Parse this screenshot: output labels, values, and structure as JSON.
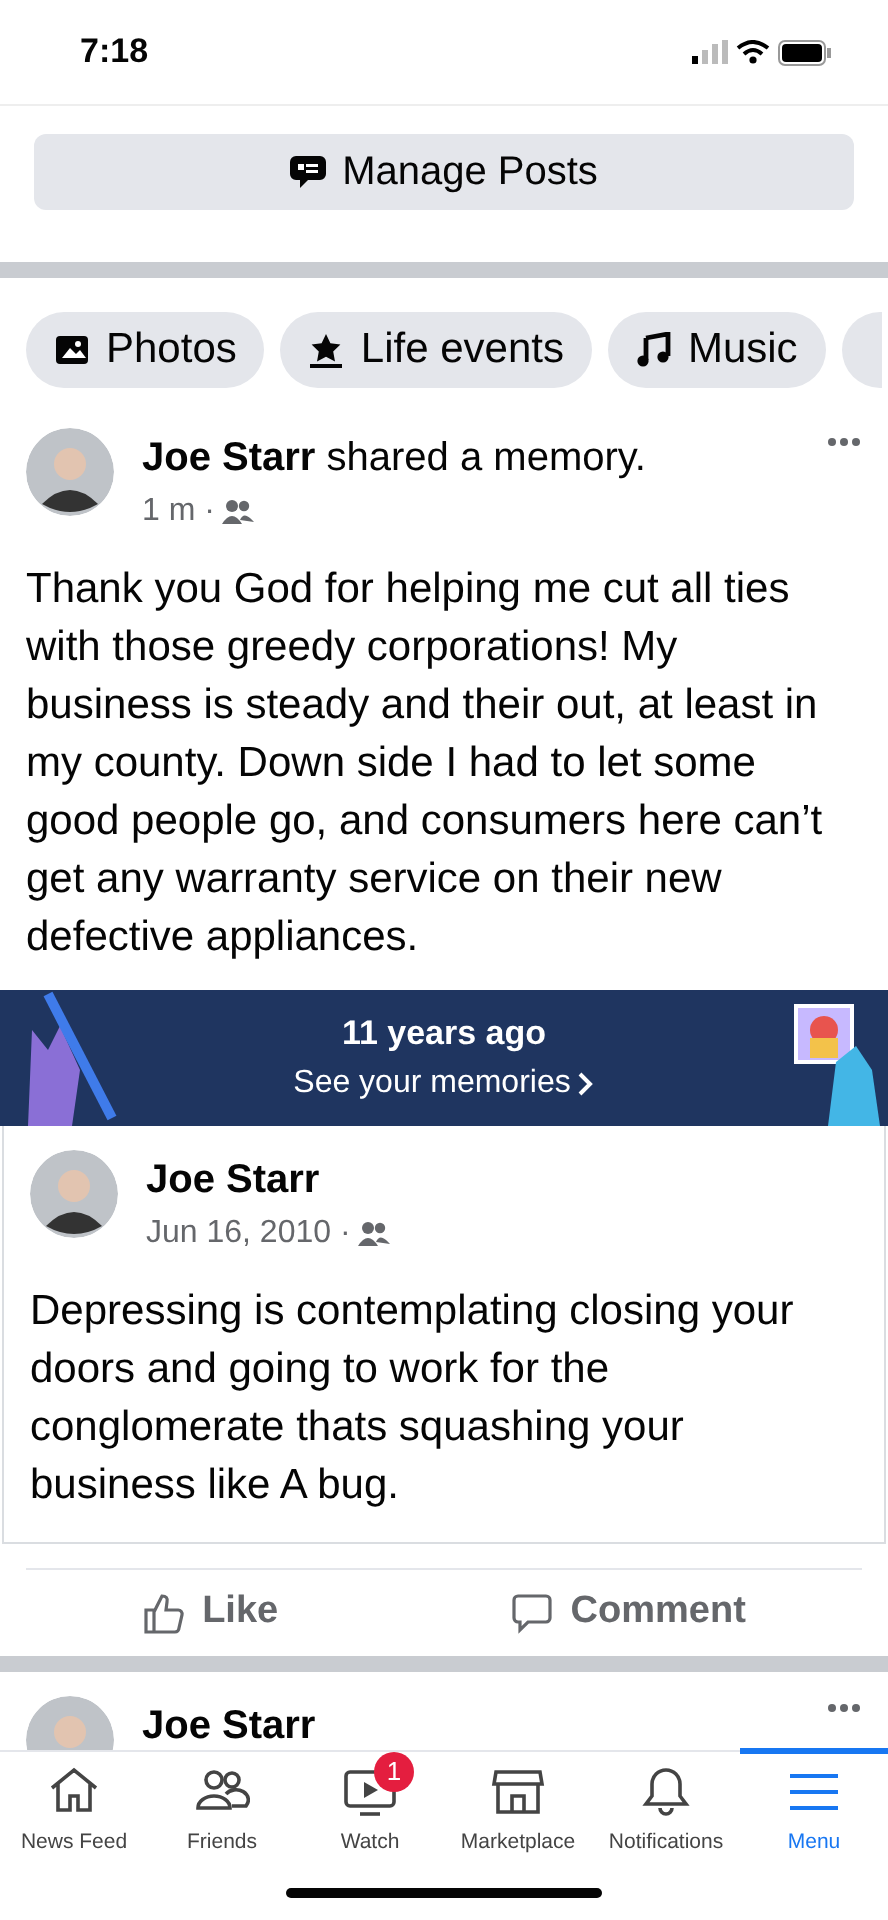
{
  "status_bar": {
    "time": "7:18"
  },
  "manage_posts_button": {
    "label": "Manage Posts"
  },
  "filter_chips": [
    {
      "label": "Photos",
      "kind": "photos"
    },
    {
      "label": "Life events",
      "kind": "life_events"
    },
    {
      "label": "Music",
      "kind": "music"
    },
    {
      "kind": "partial"
    }
  ],
  "memory_post": {
    "header": "**Joe Starr** shared a memory.",
    "meta": "1 m ·",
    "text": "Thank you God for helping me cut all ties with those greedy corporations! My business is steady and their out, at least in my county. Down side I had to let some good people go, and consumers here can’t get any warranty service on their new defective appliances."
  },
  "memory_banner": {
    "title": "11 years ago",
    "link": "See your memories"
  },
  "shared_post": {
    "author": "Joe Starr",
    "meta": "Jun 16, 2010 ·",
    "text": "Depressing is contemplating closing your doors and going to work for the conglomerate thats squashing your business like A bug."
  },
  "actions": [
    {
      "label": "Like",
      "kind": "like"
    },
    {
      "label": "Comment",
      "kind": "comment"
    }
  ],
  "next_post": {
    "author": "Joe Starr"
  },
  "tab_bar": [
    {
      "label": "News Feed",
      "kind": "home",
      "selected": false
    },
    {
      "label": "Friends",
      "kind": "friends",
      "selected": false
    },
    {
      "label": "Watch",
      "kind": "watch",
      "selected": false,
      "badge": "1"
    },
    {
      "label": "Marketplace",
      "kind": "marketplace",
      "selected": false
    },
    {
      "label": "Notifications",
      "kind": "notifications",
      "selected": false
    },
    {
      "label": "Menu",
      "kind": "menu",
      "selected": true
    }
  ]
}
